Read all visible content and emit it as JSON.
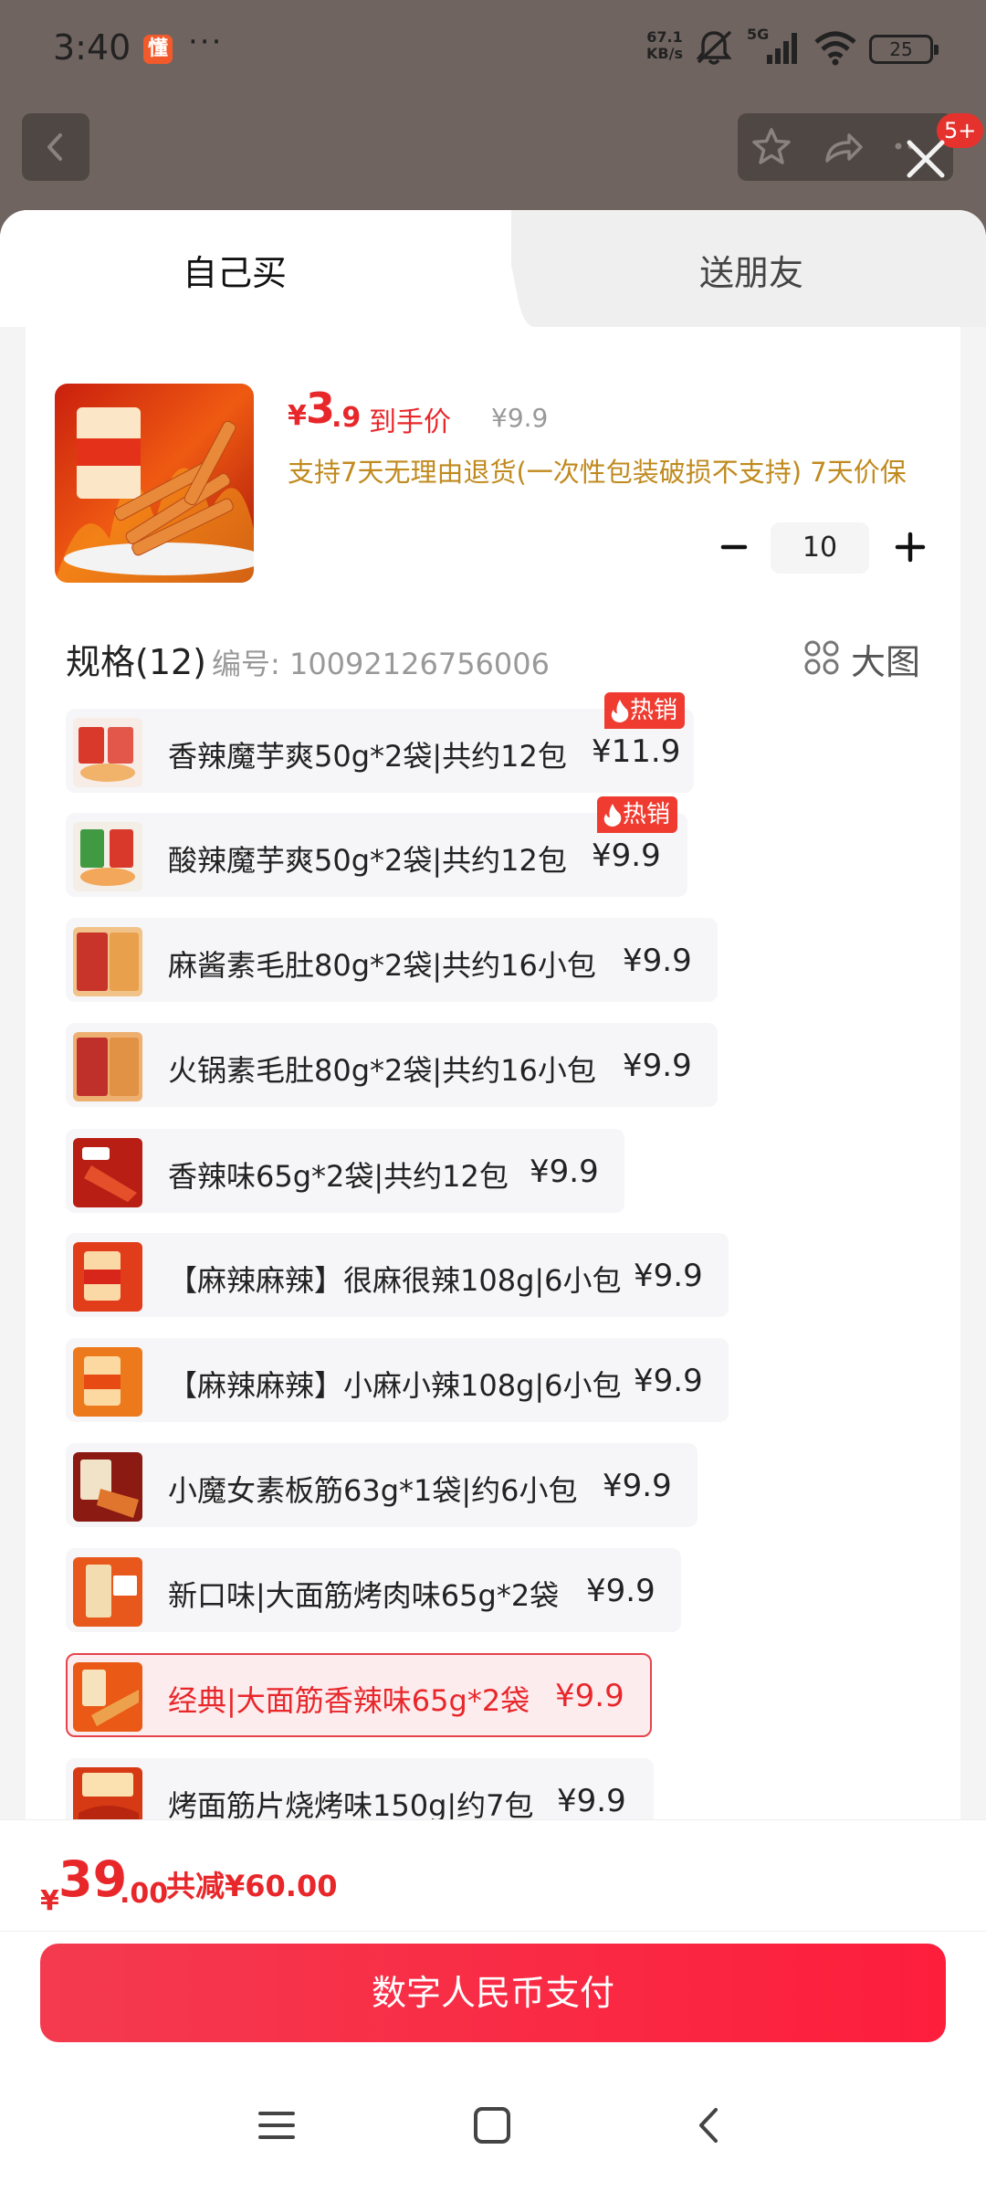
{
  "status_bar": {
    "time": "3:40",
    "app_icon_char": "懂",
    "more": "···",
    "net_speed_value": "67.1",
    "net_speed_unit": "KB/s",
    "network": "5G",
    "battery": "25"
  },
  "header": {
    "badge": "5+"
  },
  "tabs": {
    "self_buy": "自己买",
    "send_friend": "送朋友"
  },
  "product": {
    "price_currency": "¥",
    "price_int": "3",
    "price_dec": ".9",
    "price_tag": "到手价",
    "original_price": "¥9.9",
    "policy": "支持7天无理由退货(一次性包装破损不支持) 7天价保"
  },
  "quantity": {
    "value": "10"
  },
  "spec": {
    "title": "规格(12)",
    "code": "编号: 10092126756006",
    "big_view": "大图"
  },
  "hot_badge_label": "热销",
  "sku_list": [
    {
      "name": "香辣魔芋爽50g*2袋|共约12包",
      "price": "¥11.9",
      "hot": true
    },
    {
      "name": "酸辣魔芋爽50g*2袋|共约12包",
      "price": "¥9.9",
      "hot": true
    },
    {
      "name": "麻酱素毛肚80g*2袋|共约16小包",
      "price": "¥9.9",
      "hot": false
    },
    {
      "name": "火锅素毛肚80g*2袋|共约16小包",
      "price": "¥9.9",
      "hot": false
    },
    {
      "name": "香辣味65g*2袋|共约12包",
      "price": "¥9.9",
      "hot": false
    },
    {
      "name": "【麻辣麻辣】很麻很辣108g|6小包",
      "price": "¥9.9",
      "hot": false
    },
    {
      "name": "【麻辣麻辣】小麻小辣108g|6小包",
      "price": "¥9.9",
      "hot": false
    },
    {
      "name": "小魔女素板筋63g*1袋|约6小包",
      "price": "¥9.9",
      "hot": false
    },
    {
      "name": "新口味|大面筋烤肉味65g*2袋",
      "price": "¥9.9",
      "hot": false
    },
    {
      "name": "经典|大面筋香辣味65g*2袋",
      "price": "¥9.9",
      "hot": false,
      "selected": true
    },
    {
      "name": "烤面筋片烧烤味150g|约7包",
      "price": "¥9.9",
      "hot": false
    }
  ],
  "total": {
    "currency": "¥",
    "int": "39",
    "dec": ".00",
    "saved": "共减¥60.00"
  },
  "pay_button": "数字人民币支付",
  "colors": {
    "accent_red": "#e8272b",
    "policy_gold": "#c08a1e",
    "pay_gradient_start": "#f43a4f",
    "pay_gradient_end": "#fd1e3c"
  }
}
